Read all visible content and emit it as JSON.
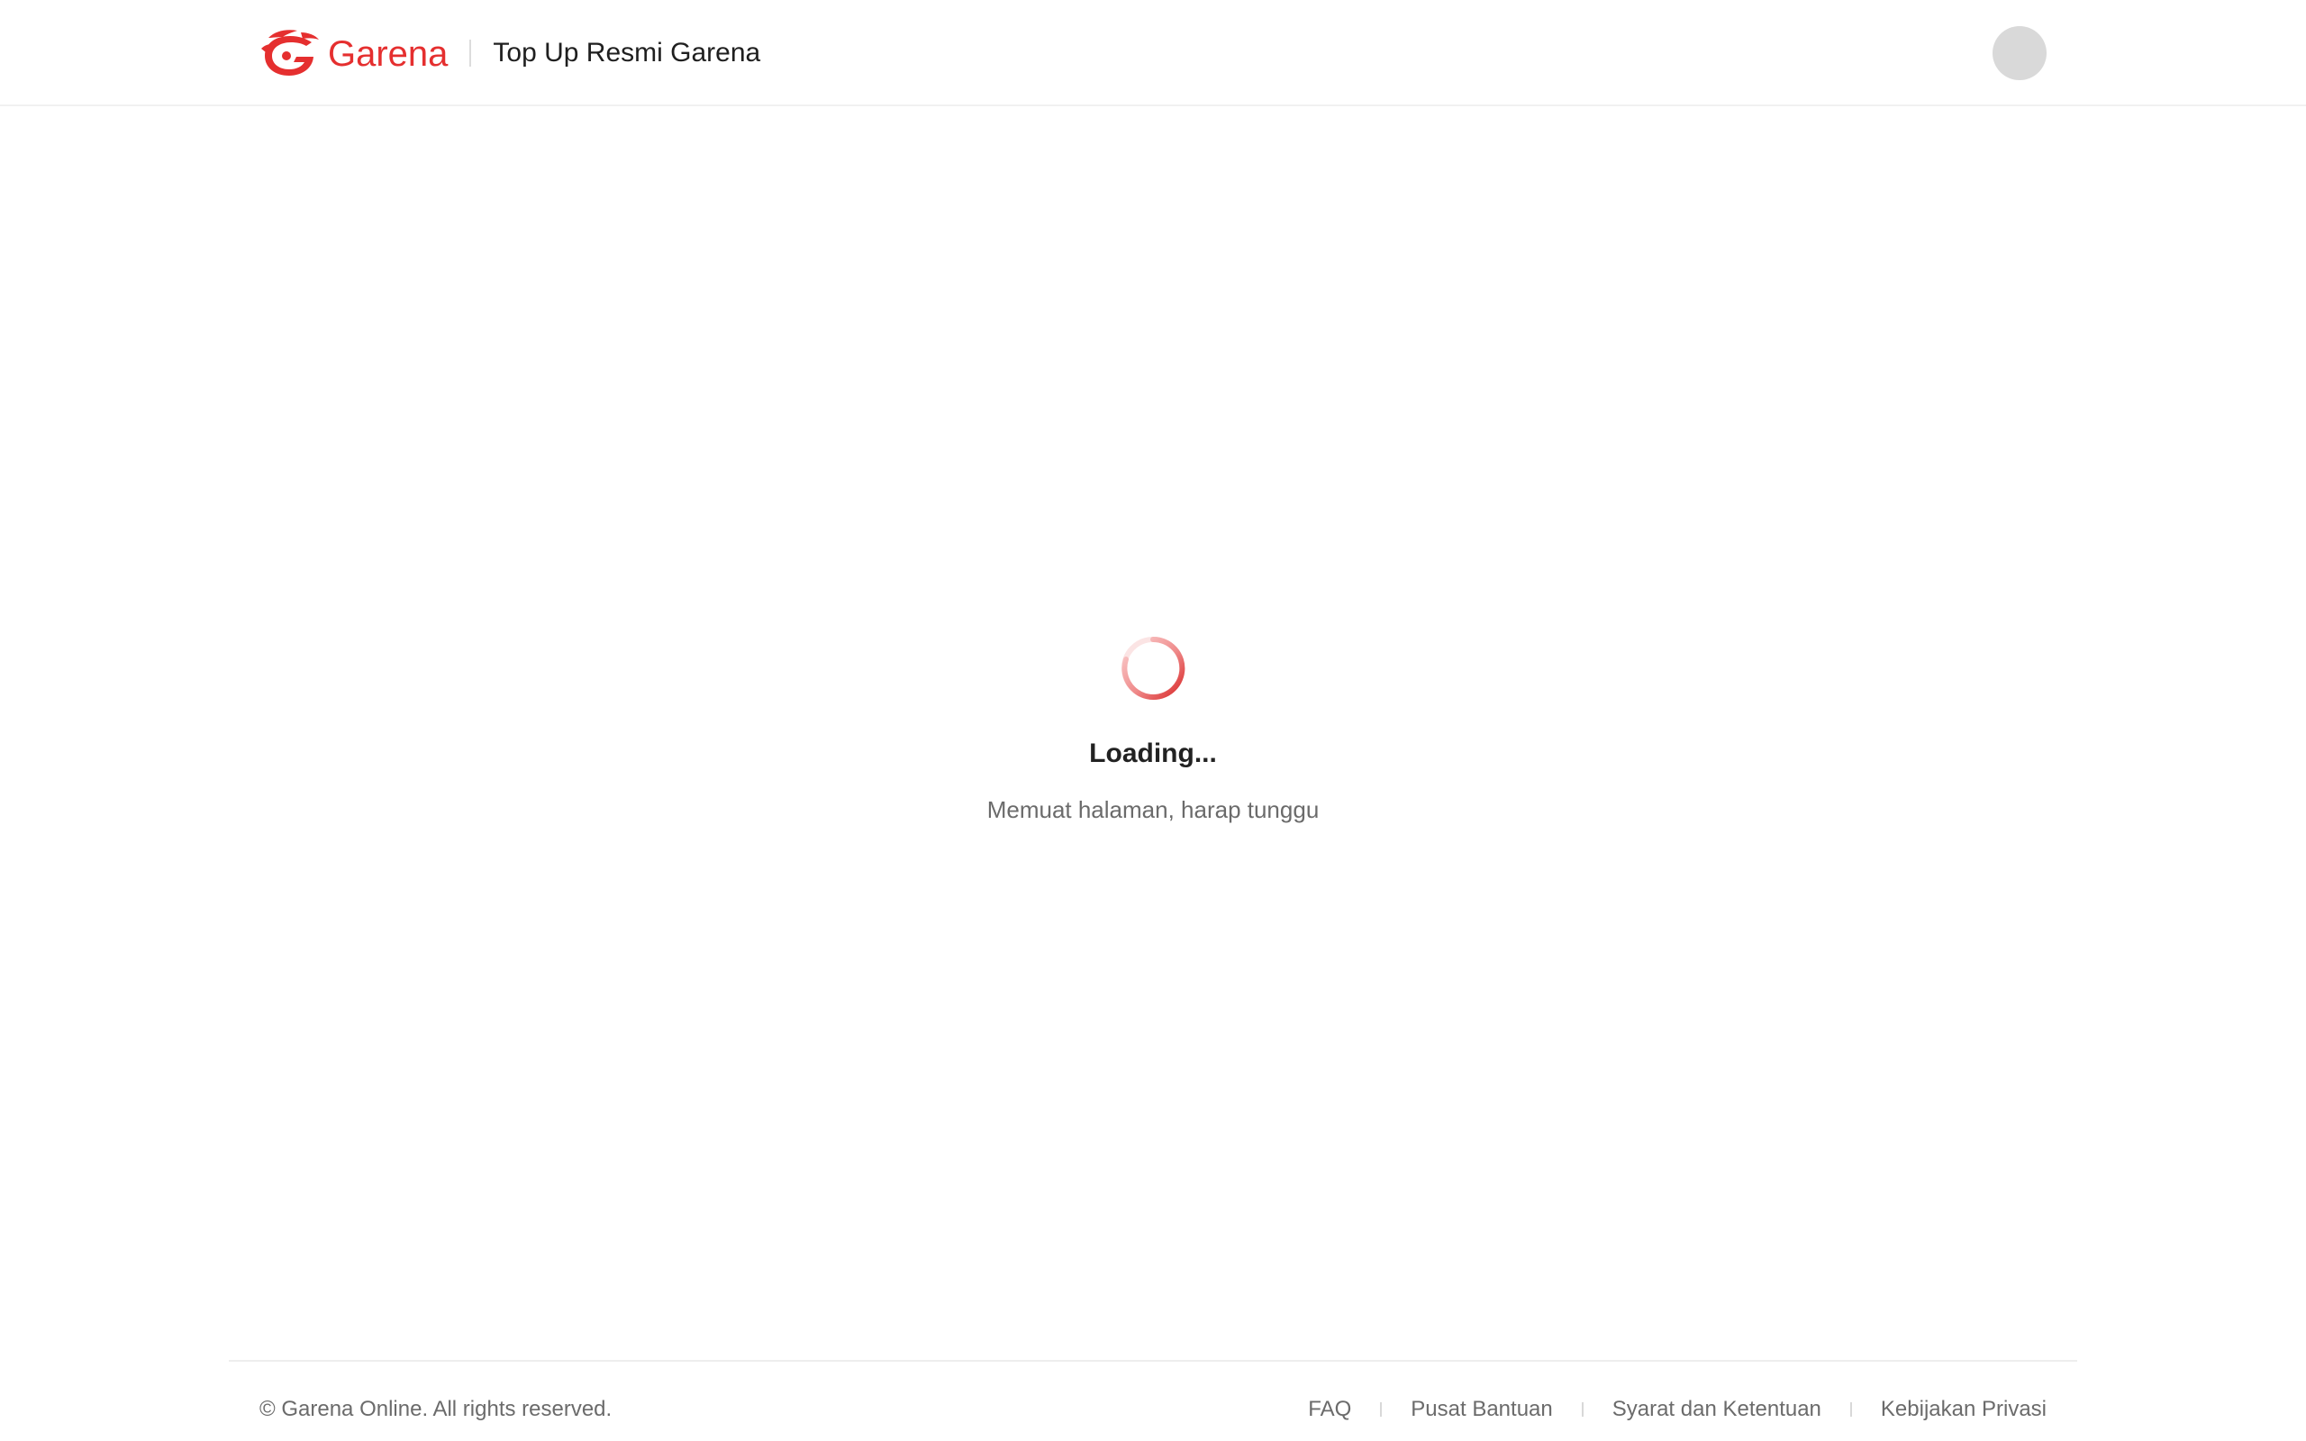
{
  "header": {
    "logo_text": "Garena",
    "title": "Top Up Resmi Garena",
    "logo_icon": "garena-dragon-logo",
    "avatar_icon": "user-avatar-placeholder"
  },
  "loader": {
    "spinner_icon": "loading-spinner-icon",
    "title": "Loading...",
    "subtitle": "Memuat halaman, harap tunggu"
  },
  "footer": {
    "copyright": "© Garena Online. All rights reserved.",
    "links": [
      {
        "label": "FAQ"
      },
      {
        "label": "Pusat Bantuan"
      },
      {
        "label": "Syarat dan Ketentuan"
      },
      {
        "label": "Kebijakan Privasi"
      }
    ]
  },
  "colors": {
    "brand_red": "#e52f2f",
    "text_dark": "#1f1f1f",
    "text_muted": "#6b6b6b",
    "avatar_bg": "#d9d9d9"
  }
}
